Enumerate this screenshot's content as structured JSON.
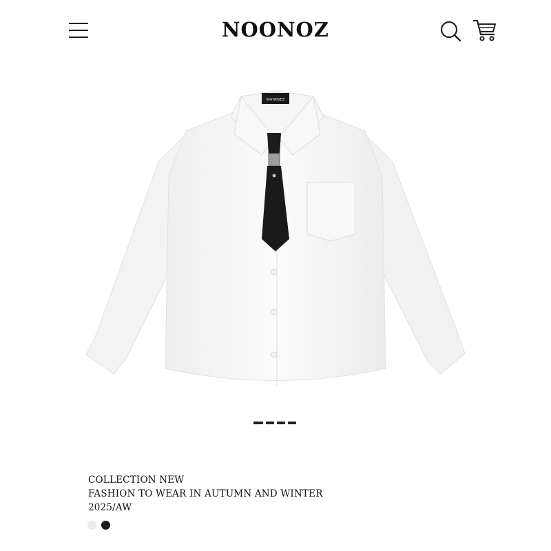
{
  "header": {
    "brand": "NOONOZ",
    "menu_icon": "hamburger-menu-icon",
    "search_icon": "search-icon",
    "cart_icon": "shopping-cart-icon"
  },
  "hero": {
    "subject": "white long-sleeve shirt with black tie",
    "label_text": "WATAWEE"
  },
  "carousel": {
    "count": 4,
    "active_index": 0
  },
  "product": {
    "line1": "COLLECTION NEW",
    "line2": "FASHION TO WEAR IN AUTUMN AND WINTER",
    "line3": "2025/AW",
    "colors": [
      {
        "name": "white",
        "hex": "#ebebeb"
      },
      {
        "name": "black",
        "hex": "#1e1e1e"
      }
    ]
  }
}
